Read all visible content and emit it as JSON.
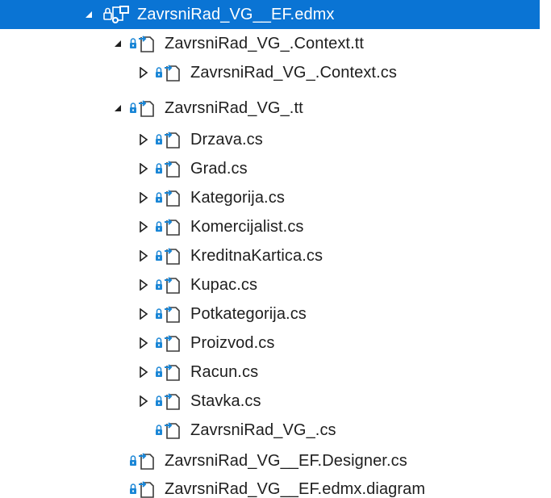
{
  "tree": {
    "root": {
      "label": "ZavrsniRad_VG__EF.edmx",
      "icon": "edmx-file-icon",
      "expanded": true
    },
    "items": [
      {
        "label": "ZavrsniRad_VG_.Context.tt",
        "expanded": true
      },
      {
        "label": "ZavrsniRad_VG_.Context.cs",
        "expanded": false
      },
      {
        "label": "ZavrsniRad_VG_.tt",
        "expanded": true
      },
      {
        "label": "Drzava.cs",
        "expanded": false
      },
      {
        "label": "Grad.cs",
        "expanded": false
      },
      {
        "label": "Kategorija.cs",
        "expanded": false
      },
      {
        "label": "Komercijalist.cs",
        "expanded": false
      },
      {
        "label": "KreditnaKartica.cs",
        "expanded": false
      },
      {
        "label": "Kupac.cs",
        "expanded": false
      },
      {
        "label": "Potkategorija.cs",
        "expanded": false
      },
      {
        "label": "Proizvod.cs",
        "expanded": false
      },
      {
        "label": "Racun.cs",
        "expanded": false
      },
      {
        "label": "Stavka.cs",
        "expanded": false
      },
      {
        "label": "ZavrsniRad_VG_.cs"
      },
      {
        "label": "ZavrsniRad_VG__EF.Designer.cs"
      },
      {
        "label": "ZavrsniRad_VG__EF.edmx.diagram"
      }
    ]
  },
  "colors": {
    "selection": "#0a74d4",
    "text": "#1e1e1e",
    "lock": "#1a86d6",
    "file_outline": "#3a3a3a",
    "arrow_badge": "#1a86d6"
  }
}
